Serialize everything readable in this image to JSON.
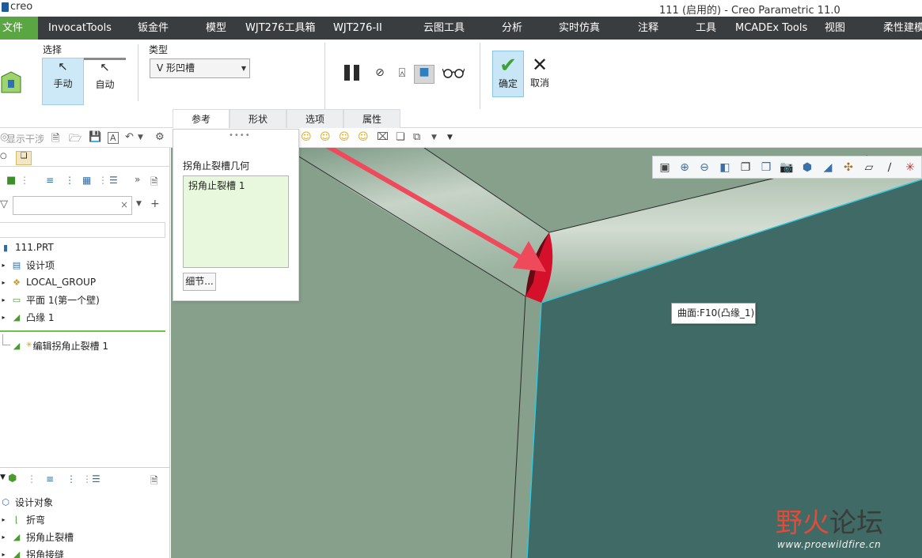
{
  "titlebar": {
    "logo": "creo",
    "window_title": "111 (启用的) - Creo Parametric 11.0"
  },
  "menubar": {
    "items": [
      "文件",
      "InvocatTools",
      "钣金件",
      "模型",
      "WJT276工具箱",
      "WJT276-II",
      "云图工具",
      "分析",
      "实时仿真",
      "注释",
      "工具",
      "MCADEx Tools",
      "视图",
      "柔性建模"
    ]
  },
  "ribbon": {
    "select_group_label": "选择",
    "manual_label": "手动",
    "auto_label": "自动",
    "type_group_label": "类型",
    "type_value": "V 形凹槽",
    "ok_label": "确定",
    "cancel_label": "取消",
    "tabs": [
      "参考",
      "形状",
      "选项",
      "属性"
    ]
  },
  "graphics_toolbar": {
    "show_interference": "显示干涉"
  },
  "ref_panel": {
    "title": "拐角止裂槽几何",
    "list_item": "拐角止裂槽 1",
    "details_button": "细节..."
  },
  "model_tree": {
    "items": [
      "111.PRT",
      "设计项",
      "LOCAL_GROUP",
      "平面 1(第一个壁)",
      "凸缘 1"
    ],
    "editing_item": "编辑拐角止裂槽 1"
  },
  "design_tree": {
    "items": [
      "设计对象",
      "折弯",
      "拐角止裂槽",
      "拐角接缝"
    ]
  },
  "viewport": {
    "tooltip": "曲面:F10(凸缘_1)"
  },
  "watermark": {
    "text_red": "野火",
    "text_dark": "论坛",
    "url": "www.proewildfire.cn"
  },
  "colors": {
    "menubar": "#3a3d40",
    "file_menu": "#5aa642",
    "model_flat": "#86a08c",
    "model_face_dark": "#3f6a65",
    "highlight_edge": "#34c6dc",
    "relief_red": "#d5102a",
    "arrow": "#ef4a5c",
    "list_bg": "#e8f8dc"
  }
}
